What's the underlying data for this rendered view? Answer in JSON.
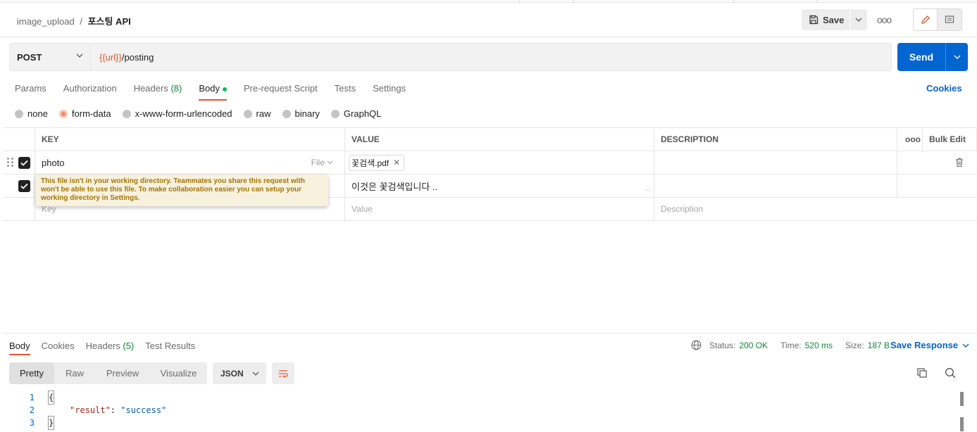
{
  "breadcrumb": {
    "collection": "image_upload",
    "separator": "/",
    "request": "포스팅 API"
  },
  "toolbar": {
    "save_label": "Save",
    "more_label": "ooo"
  },
  "request": {
    "method": "POST",
    "url_var": "{{url}}",
    "url_path": "/posting",
    "send_label": "Send"
  },
  "request_tabs": [
    {
      "label": "Params"
    },
    {
      "label": "Authorization"
    },
    {
      "label": "Headers",
      "count": "(8)"
    },
    {
      "label": "Body",
      "active": true
    },
    {
      "label": "Pre-request Script"
    },
    {
      "label": "Tests"
    },
    {
      "label": "Settings"
    }
  ],
  "cookies_label": "Cookies",
  "body_types": [
    {
      "label": "none"
    },
    {
      "label": "form-data",
      "selected": true
    },
    {
      "label": "x-www-form-urlencoded"
    },
    {
      "label": "raw"
    },
    {
      "label": "binary"
    },
    {
      "label": "GraphQL"
    }
  ],
  "table": {
    "headers": {
      "key": "KEY",
      "value": "VALUE",
      "description": "DESCRIPTION",
      "more": "ooo",
      "bulk_edit": "Bulk Edit"
    },
    "rows": [
      {
        "key": "photo",
        "type_label": "File",
        "value": "꽃검색.pdf",
        "description": ""
      },
      {
        "key": "",
        "value": "이것은 꽃검색입니다 ..",
        "description": "",
        "value_ellipsis": "..."
      }
    ],
    "placeholders": {
      "key": "Key",
      "value": "Value",
      "description": "Description"
    }
  },
  "tooltip": {
    "line1": "This file isn't in your working directory. Teammates you share this request with",
    "line2": "won't be able to use this file. To make collaboration easier you can setup your",
    "line3": "working directory in Settings."
  },
  "response_tabs": [
    {
      "label": "Body",
      "active": true
    },
    {
      "label": "Cookies"
    },
    {
      "label": "Headers",
      "count": "(5)"
    },
    {
      "label": "Test Results"
    }
  ],
  "response_meta": {
    "status_label": "Status:",
    "status_value": "200 OK",
    "time_label": "Time:",
    "time_value": "520 ms",
    "size_label": "Size:",
    "size_value": "187 B",
    "save_response_label": "Save Response"
  },
  "view_modes": [
    "Pretty",
    "Raw",
    "Preview",
    "Visualize"
  ],
  "format": "JSON",
  "code_lines": [
    {
      "n": "1",
      "text": "{"
    },
    {
      "n": "2",
      "key": "\"result\"",
      "colon": ": ",
      "value": "\"success\""
    },
    {
      "n": "3",
      "text": "}"
    }
  ],
  "colors": {
    "accent": "#e4572e",
    "primary": "#0265d2",
    "success": "#0f8a3e",
    "warning_text": "#a47400"
  }
}
